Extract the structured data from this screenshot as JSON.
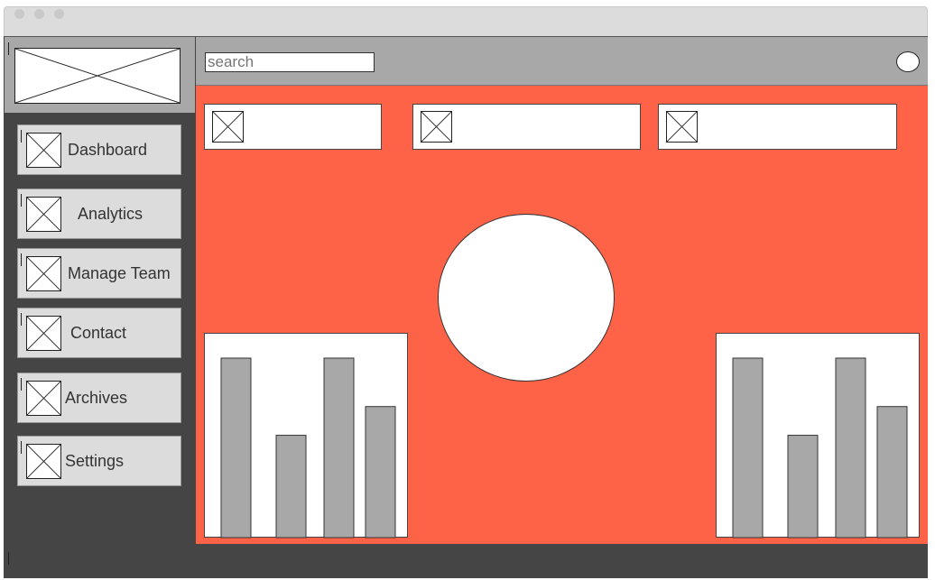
{
  "search": {
    "placeholder": "search"
  },
  "sidebar": {
    "items": [
      {
        "label": "Dashboard",
        "icon": "image-placeholder-icon"
      },
      {
        "label": "Analytics",
        "icon": "image-placeholder-icon"
      },
      {
        "label": "Manage Team",
        "icon": "image-placeholder-icon"
      },
      {
        "label": "Contact",
        "icon": "image-placeholder-icon"
      },
      {
        "label": "Archives",
        "icon": "image-placeholder-icon"
      },
      {
        "label": "Settings",
        "icon": "image-placeholder-icon"
      }
    ]
  },
  "colors": {
    "main_background": "#ff6347",
    "sidebar_background": "#454545",
    "topbar_background": "#a8a8a8",
    "nav_button": "#dcdcdc",
    "bar_fill": "#a8a8a8"
  },
  "chart_data": [
    {
      "type": "bar",
      "categories": [
        "",
        "",
        "",
        ""
      ],
      "values": [
        100,
        57,
        100,
        73
      ],
      "ylim": [
        0,
        100
      ]
    },
    {
      "type": "bar",
      "categories": [
        "",
        "",
        "",
        ""
      ],
      "values": [
        100,
        57,
        100,
        73
      ],
      "ylim": [
        0,
        100
      ]
    }
  ]
}
